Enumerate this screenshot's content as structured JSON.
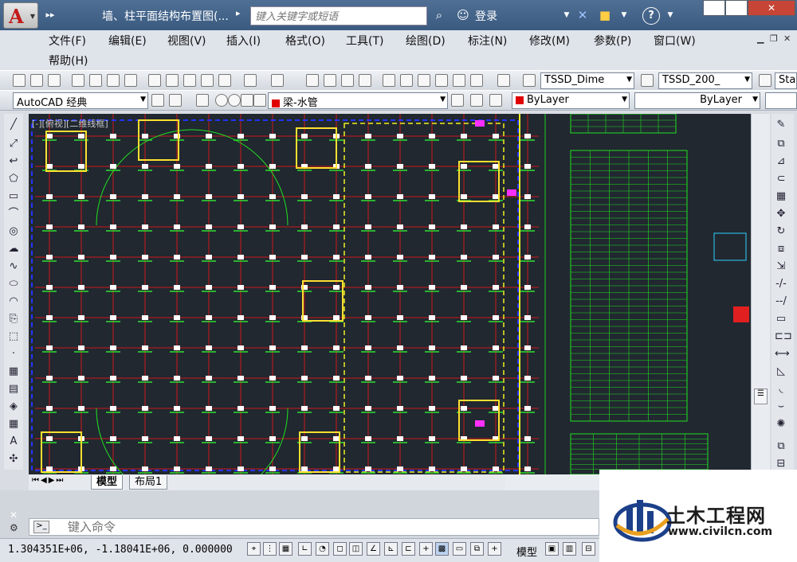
{
  "titlebar": {
    "document_title": "墙、柱平面结构布置图(...",
    "search_placeholder": "键入关键字或短语",
    "login_label": "登录",
    "help_label": "?"
  },
  "menu": {
    "items": [
      "文件(F)",
      "编辑(E)",
      "视图(V)",
      "插入(I)",
      "格式(O)",
      "工具(T)",
      "绘图(D)",
      "标注(N)",
      "修改(M)",
      "参数(P)",
      "窗口(W)",
      "帮助(H)"
    ]
  },
  "toolbar": {
    "text_style": "TSSD_Dime",
    "dim_style": "TSSD_200_",
    "table_style": "Sta",
    "workspace": "AutoCAD 经典",
    "layer": "梁-水管",
    "color": "ByLayer",
    "linetype": "ByLayer",
    "layer_color": "#e00000"
  },
  "viewport": {
    "label": "[-][俯视][二维线框]"
  },
  "tabs": [
    "模型",
    "布局1"
  ],
  "command": {
    "placeholder": "键入命令"
  },
  "status": {
    "coordinates": "1.304351E+06, -1.18041E+06, 0.000000",
    "model_label": "模型"
  },
  "watermark": {
    "title": "土木工程网",
    "url": "www.civilcn.com"
  }
}
